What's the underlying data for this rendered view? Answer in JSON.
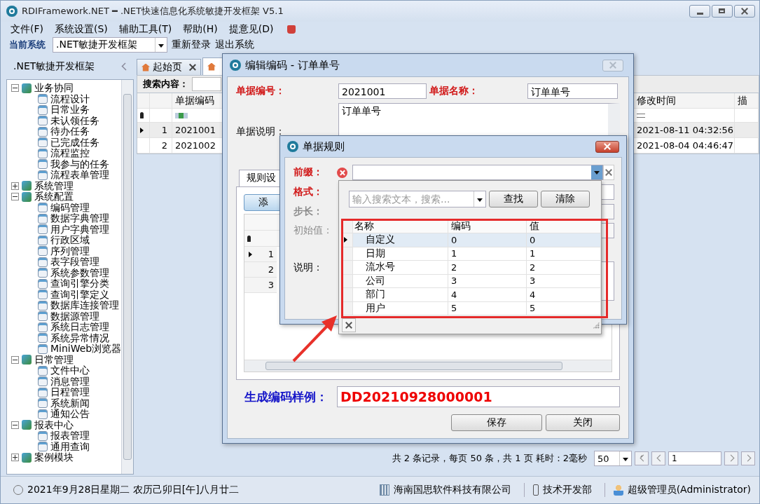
{
  "window": {
    "title": "RDIFramework.NET ━ .NET快速信息化系统敏捷开发框架 V5.1"
  },
  "menu": [
    {
      "label": "文件(F)"
    },
    {
      "label": "系统设置(S)"
    },
    {
      "label": "辅助工具(T)"
    },
    {
      "label": "帮助(H)"
    },
    {
      "label": "提意见(D)"
    }
  ],
  "toolbar": {
    "label": "当前系统",
    "system": ".NET敏捷开发框架",
    "actions": [
      "重新登录",
      "退出系统"
    ]
  },
  "sidebar": {
    "title": ".NET敏捷开发框架",
    "tree": [
      {
        "label": "业务协同",
        "expanded": true,
        "children": [
          {
            "label": "流程设计"
          },
          {
            "label": "日常业务"
          },
          {
            "label": "未认领任务"
          },
          {
            "label": "待办任务"
          },
          {
            "label": "已完成任务"
          },
          {
            "label": "流程监控"
          },
          {
            "label": "我参与的任务"
          },
          {
            "label": "流程表单管理"
          }
        ]
      },
      {
        "label": "系统管理",
        "expanded": false
      },
      {
        "label": "系统配置",
        "expanded": true,
        "children": [
          {
            "label": "编码管理"
          },
          {
            "label": "数据字典管理"
          },
          {
            "label": "用户字典管理"
          },
          {
            "label": "行政区域"
          },
          {
            "label": "序列管理"
          },
          {
            "label": "表字段管理"
          },
          {
            "label": "系统参数管理"
          },
          {
            "label": "查询引擎分类"
          },
          {
            "label": "查询引擎定义"
          },
          {
            "label": "数据库连接管理"
          },
          {
            "label": "数据源管理"
          },
          {
            "label": "系统日志管理"
          },
          {
            "label": "系统异常情况"
          },
          {
            "label": "MiniWeb浏览器"
          }
        ]
      },
      {
        "label": "日常管理",
        "expanded": true,
        "children": [
          {
            "label": "文件中心"
          },
          {
            "label": "消息管理"
          },
          {
            "label": "日程管理"
          },
          {
            "label": "系统新闻"
          },
          {
            "label": "通知公告"
          }
        ]
      },
      {
        "label": "报表中心",
        "expanded": true,
        "children": [
          {
            "label": "报表管理"
          },
          {
            "label": "通用查询"
          }
        ]
      },
      {
        "label": "案例模块",
        "expanded": false
      }
    ]
  },
  "tabs": [
    {
      "label": "起始页",
      "selected": false
    },
    {
      "selected": true
    }
  ],
  "search": {
    "label": "搜索内容："
  },
  "table": {
    "columns": [
      "单据编码",
      "修改时间",
      "描"
    ],
    "rows": [
      {
        "number": "1",
        "code": "2021001",
        "modified": "2021-08-11 04:32:56",
        "selected": true
      },
      {
        "number": "2",
        "code": "2021002",
        "modified": "2021-08-04 04:46:47",
        "selected": false
      }
    ]
  },
  "pager": {
    "summary": "共 2 条记录，每页 50 条，共 1 页 耗时：2毫秒",
    "page_size": "50",
    "page": "1"
  },
  "edit_dialog": {
    "title": "编辑编码 - 订单单号",
    "code_label": "单据编号：",
    "code": "2021001",
    "name_label": "单据名称：",
    "name": "订单单号",
    "desc_label": "单据说明：",
    "desc": "订单单号",
    "tab": "规则设",
    "add_button": "添",
    "rows": [
      "1",
      "2",
      "3"
    ],
    "sample_label": "生成编码样例：",
    "sample": "DD20210928000001",
    "buttons": [
      "保存",
      "关闭"
    ]
  },
  "rule_dialog": {
    "title": "单据规则",
    "fields": [
      {
        "label": "前缀：",
        "required": true,
        "disabled": false,
        "error": true
      },
      {
        "label": "格式：",
        "required": true,
        "disabled": false,
        "error": false
      },
      {
        "label": "步长：",
        "required": true,
        "disabled": true,
        "error": false
      },
      {
        "label": "初始值：",
        "required": false,
        "disabled": true,
        "error": false
      },
      {
        "label": "说明：",
        "required": false,
        "disabled": false,
        "error": false
      }
    ]
  },
  "popup": {
    "placeholder": "输入搜索文本，搜索...",
    "buttons": [
      "查找",
      "清除"
    ],
    "columns": [
      "名称",
      "编码",
      "值"
    ],
    "rows": [
      {
        "name": "自定义",
        "code": "0",
        "value": "0",
        "selected": true
      },
      {
        "name": "日期",
        "code": "1",
        "value": "1",
        "selected": false
      },
      {
        "name": "流水号",
        "code": "2",
        "value": "2",
        "selected": false
      },
      {
        "name": "公司",
        "code": "3",
        "value": "3",
        "selected": false
      },
      {
        "name": "部门",
        "code": "4",
        "value": "4",
        "selected": false
      },
      {
        "name": "用户",
        "code": "5",
        "value": "5",
        "selected": false
      }
    ]
  },
  "status_bar": {
    "date": "2021年9月28日星期二 农历己卯日[午]八月廿二",
    "company": "海南国思软件科技有限公司",
    "department": "技术开发部",
    "user": "超级管理员(Administrator)"
  }
}
